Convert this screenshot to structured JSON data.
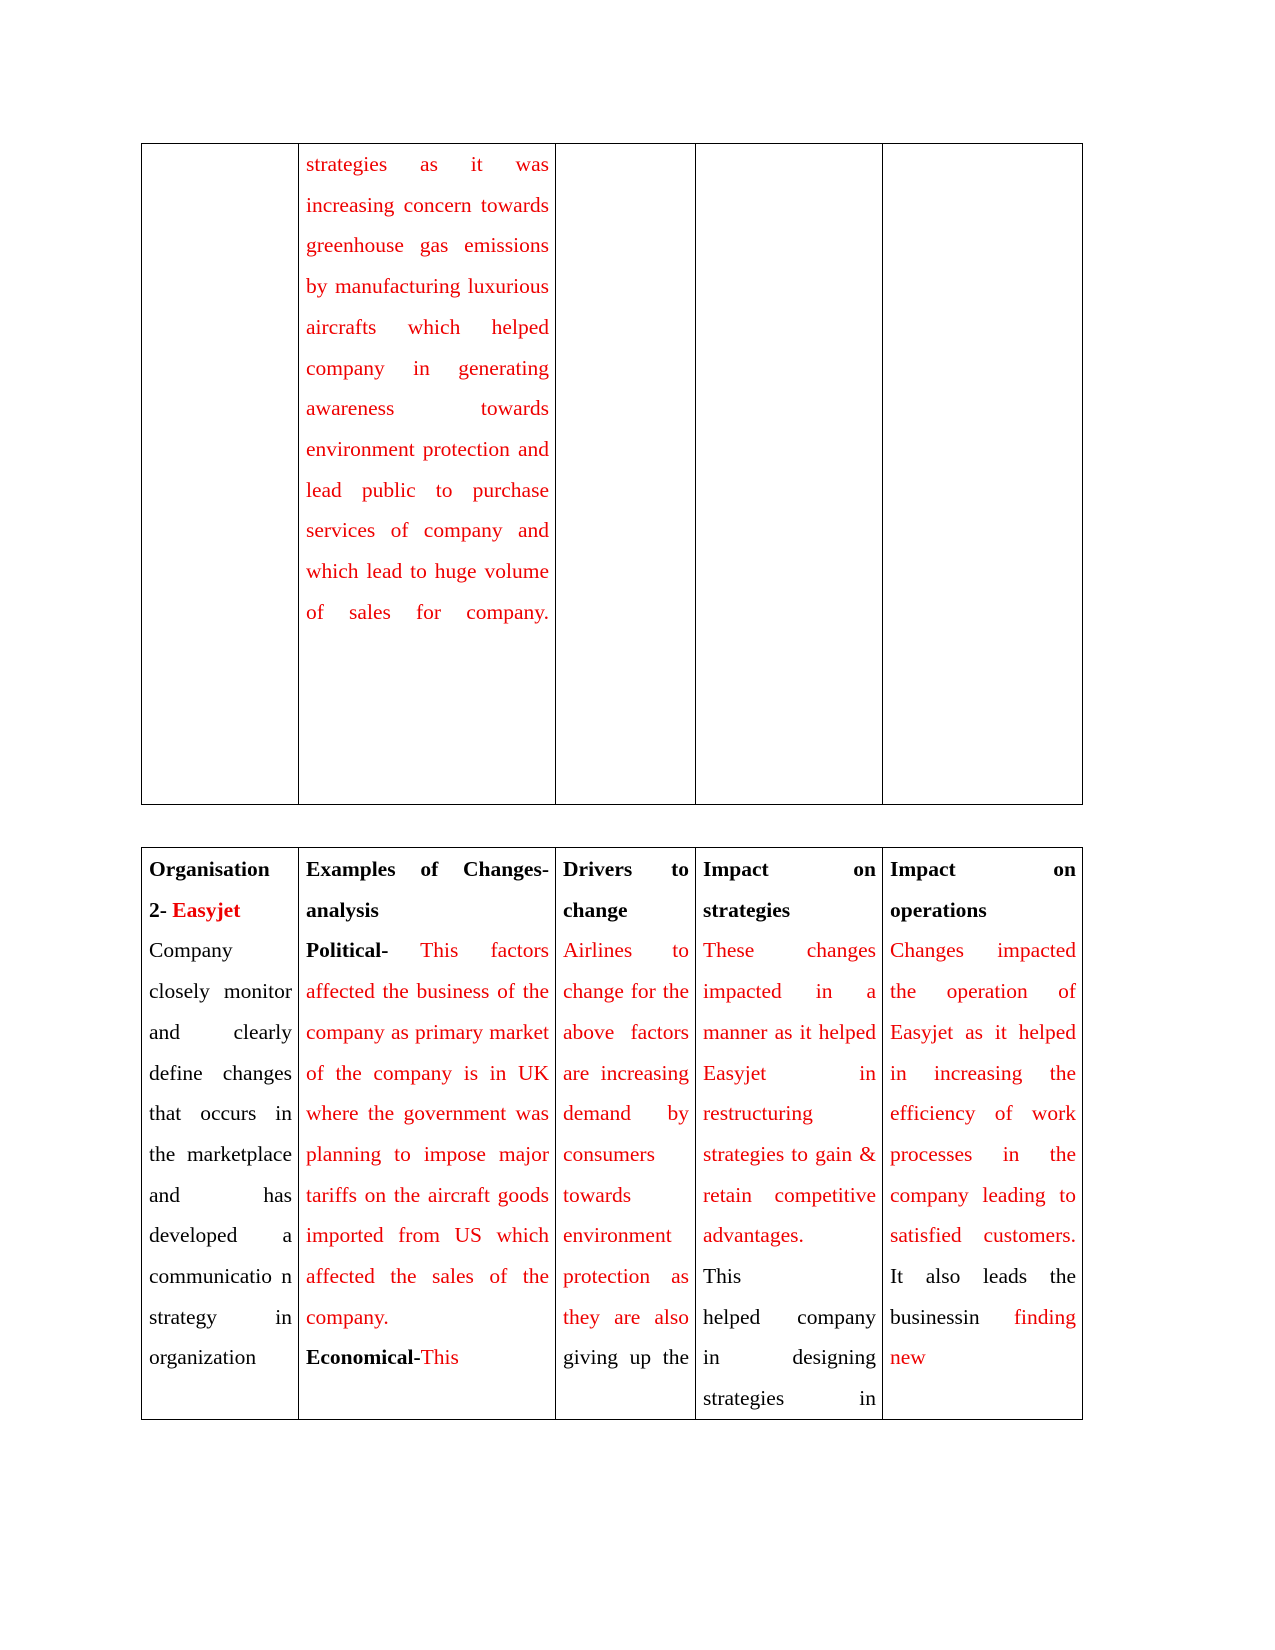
{
  "document": {
    "page_background": "#ffffff",
    "text_color_black": "#000000",
    "text_color_red": "#ee0000"
  },
  "table_one": {
    "name": "changes-analysis-continuation-table",
    "columns": 5,
    "cells": {
      "col1": "",
      "col2": "strategies as it was increasing concern towards greenhouse gas emissions by manufacturing luxurious aircrafts which helped company in generating awareness towards environment protection and lead public to purchase services of company and which lead to huge volume of sales for company.",
      "col3": "",
      "col4": "",
      "col5": ""
    }
  },
  "table_two": {
    "name": "easyjet-changes-analysis-table",
    "headers": {
      "col1_line1": "Organisation",
      "col1_line2_prefix": "2- ",
      "col1_line2_company": "Easyjet",
      "col2_line1": "Examples of Changes-",
      "col2_line2": "analysis",
      "col3_line1": "Drivers to",
      "col3_line2": "change",
      "col4_line1": "Impact on",
      "col4_line2": "strategies",
      "col5_line1": "Impact on",
      "col5_line2": "operations"
    },
    "body": {
      "col1_black": "Company closely monitor and clearly define changes that occurs in the marketplace and has developed a communicatio n strategy in organization",
      "col2_label_political": "Political-",
      "col2_political_red": " This factors affected the business of the company as primary market of the company is in UK where the government was planning to impose major tariffs on the aircraft goods imported from US which affected the sales of the company.",
      "col2_label_economical": "Economical-",
      "col2_economical_red": "This",
      "col3_red": "Airlines to change for the above factors are increasing demand by consumers towards environment protection as",
      "col3_red_cont": "they are also",
      "col3_black_cont": "giving up the",
      "col4_red": "These changes impacted in a manner as it helped Easyjet in restructuring strategies to gain & retain competitive advantages.",
      "col4_black1": "This",
      "col4_black2": "helped company",
      "col4_black3": "in designing",
      "col4_black4": "strategies in",
      "col5_red1": "Changes impacted the operation of Easyjet as it helped in increasing the efficiency of work processes in the company leading to satisfied customers.",
      "col5_black1": " It also leads the business",
      "col5_black2": "in ",
      "col5_red2": "finding new"
    }
  }
}
